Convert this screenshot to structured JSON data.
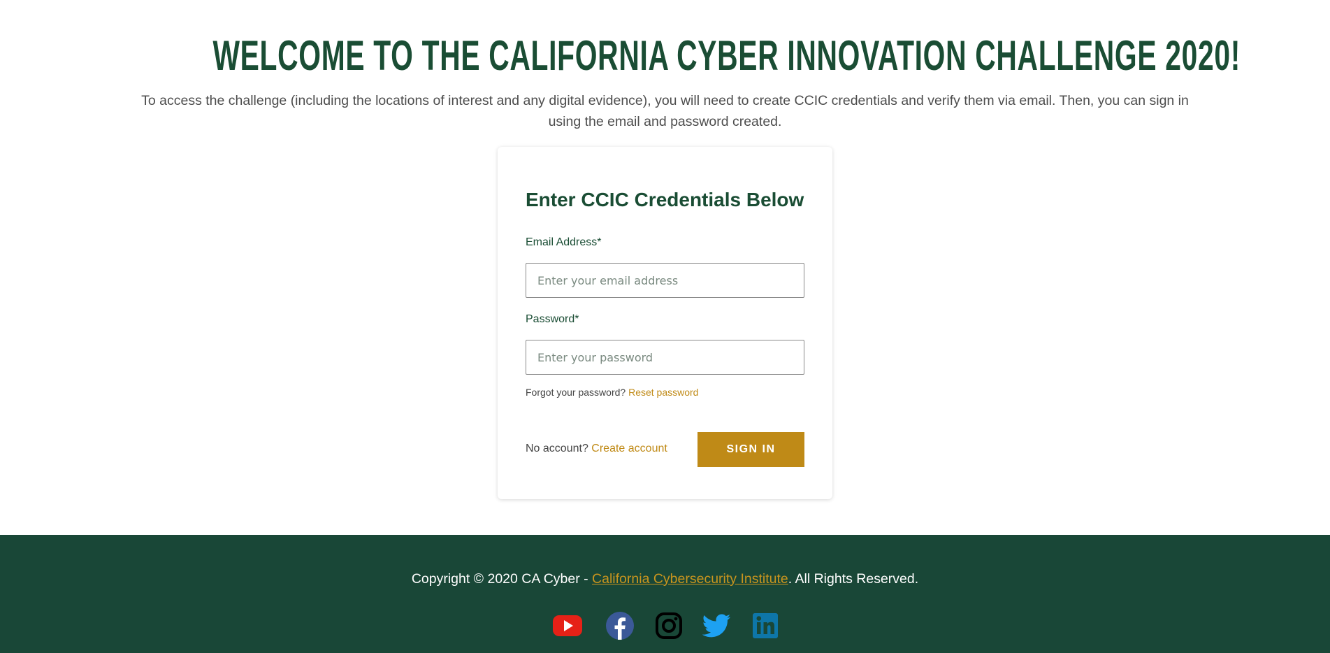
{
  "hero": {
    "title": "WELCOME TO THE CALIFORNIA CYBER INNOVATION CHALLENGE 2020!",
    "intro": "To access the challenge (including the locations of interest and any digital evidence), you will need to create CCIC credentials and verify them via email. Then, you can sign in using the email and password created."
  },
  "login": {
    "title": "Enter CCIC Credentials Below",
    "email_label": "Email Address*",
    "email_placeholder": "Enter your email address",
    "email_value": "",
    "password_label": "Password*",
    "password_placeholder": "Enter your password",
    "password_value": "",
    "forgot_text": "Forgot your password?",
    "reset_link": "Reset password",
    "no_account_text": "No account?",
    "create_link": "Create account",
    "signin_label": "SIGN IN"
  },
  "footer": {
    "copyright_prefix": "Copyright © 2020 CA Cyber - ",
    "org_link": "California Cybersecurity Institute",
    "copyright_suffix": ". All Rights Reserved.",
    "social": [
      {
        "icon": "youtube-icon",
        "color": "#e62117"
      },
      {
        "icon": "facebook-icon",
        "color": "#3b5998"
      },
      {
        "icon": "instagram-icon",
        "color": "#000000"
      },
      {
        "icon": "twitter-icon",
        "color": "#1da1f2"
      },
      {
        "icon": "linkedin-icon",
        "color": "#0e76a8"
      }
    ]
  },
  "colors": {
    "brand_green": "#1a4d34",
    "footer_green": "#194737",
    "accent_gold": "#bf8a17"
  }
}
